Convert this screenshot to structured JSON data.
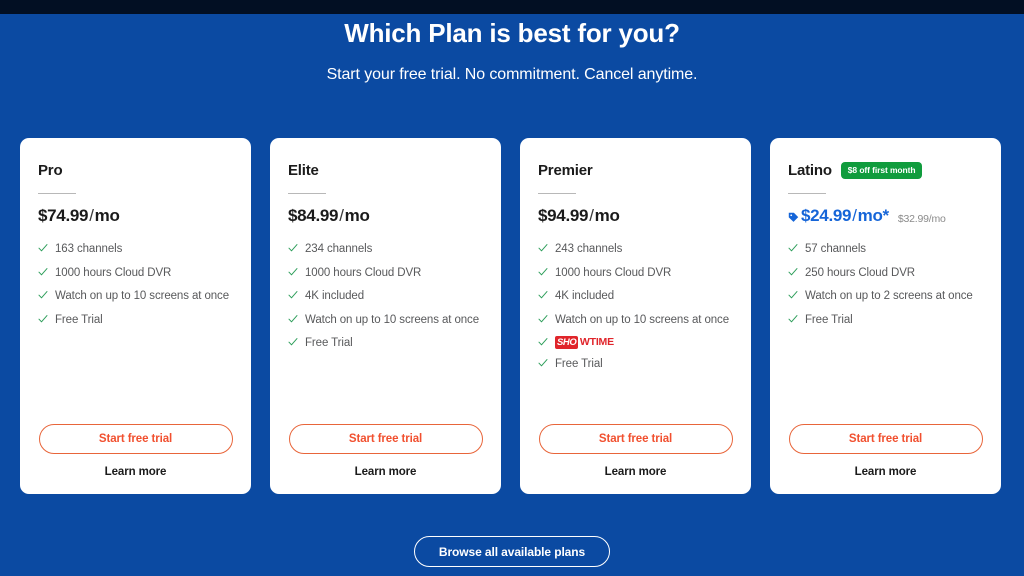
{
  "header": {
    "title": "Which Plan is best for you?",
    "subtitle": "Start your free trial. No commitment. Cancel anytime."
  },
  "colors": {
    "background": "#0b4aa2",
    "topbar": "#020f23",
    "card_background": "#ffffff",
    "cta_border": "#e8653a",
    "cta_text": "#f1502f",
    "badge_green": "#109c3d",
    "discount_blue": "#1565d8",
    "check_green": "#2e9e5b",
    "showtime_red": "#e0252b"
  },
  "plans": [
    {
      "name": "Pro",
      "price": "$74.99",
      "price_slash": "/",
      "price_period": "mo",
      "price_asterisk": "",
      "old_price": "",
      "badge": "",
      "has_tag_icon": false,
      "features": [
        {
          "label": "163 channels",
          "type": "text"
        },
        {
          "label": "1000 hours Cloud DVR",
          "type": "text"
        },
        {
          "label": "Watch on up to 10 screens at once",
          "type": "text"
        },
        {
          "label": "Free Trial",
          "type": "text"
        }
      ],
      "cta_label": "Start free trial",
      "learn_more_label": "Learn more"
    },
    {
      "name": "Elite",
      "price": "$84.99",
      "price_slash": "/",
      "price_period": "mo",
      "price_asterisk": "",
      "old_price": "",
      "badge": "",
      "has_tag_icon": false,
      "features": [
        {
          "label": "234 channels",
          "type": "text"
        },
        {
          "label": "1000 hours Cloud DVR",
          "type": "text"
        },
        {
          "label": "4K included",
          "type": "text"
        },
        {
          "label": "Watch on up to 10 screens at once",
          "type": "text"
        },
        {
          "label": "Free Trial",
          "type": "text"
        }
      ],
      "cta_label": "Start free trial",
      "learn_more_label": "Learn more"
    },
    {
      "name": "Premier",
      "price": "$94.99",
      "price_slash": "/",
      "price_period": "mo",
      "price_asterisk": "",
      "old_price": "",
      "badge": "",
      "has_tag_icon": false,
      "features": [
        {
          "label": "243 channels",
          "type": "text"
        },
        {
          "label": "1000 hours Cloud DVR",
          "type": "text"
        },
        {
          "label": "4K included",
          "type": "text"
        },
        {
          "label": "Watch on up to 10 screens at once",
          "type": "text"
        },
        {
          "label": "SHOWTIME",
          "type": "logo",
          "logo_part1": "SHO",
          "logo_part2": "WTIME"
        },
        {
          "label": "Free Trial",
          "type": "text"
        }
      ],
      "cta_label": "Start free trial",
      "learn_more_label": "Learn more"
    },
    {
      "name": "Latino",
      "price": "$24.99",
      "price_slash": "/",
      "price_period": "mo",
      "price_asterisk": "*",
      "old_price": "$32.99/mo",
      "badge": "$8 off first month",
      "has_tag_icon": true,
      "features": [
        {
          "label": "57 channels",
          "type": "text"
        },
        {
          "label": "250 hours Cloud DVR",
          "type": "text"
        },
        {
          "label": "Watch on up to 2 screens at once",
          "type": "text"
        },
        {
          "label": "Free Trial",
          "type": "text"
        }
      ],
      "cta_label": "Start free trial",
      "learn_more_label": "Learn more"
    }
  ],
  "footer": {
    "browse_label": "Browse all available plans"
  }
}
